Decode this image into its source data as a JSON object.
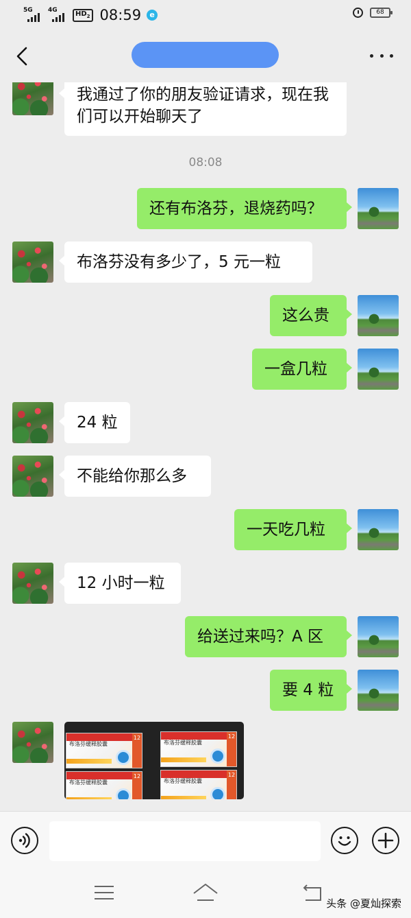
{
  "status_bar": {
    "network1": "5G",
    "network2": "4G",
    "hd_label": "HD",
    "hd_sub": "2",
    "time": "08:59",
    "app_badge": "e",
    "battery": "68"
  },
  "header": {
    "back_icon": "chevron-left-icon",
    "more_icon": "more-dots-icon"
  },
  "chat": {
    "messages": [
      {
        "side": "left",
        "type": "text",
        "text": "我通过了你的朋友验证请求，现在我们可以开始聊天了"
      },
      {
        "type": "timestamp",
        "text": "08:08"
      },
      {
        "side": "right",
        "type": "text",
        "text": "还有布洛芬，退烧药吗？"
      },
      {
        "side": "left",
        "type": "text",
        "text": "布洛芬没有多少了，5 元一粒"
      },
      {
        "side": "right",
        "type": "text",
        "text": "这么贵"
      },
      {
        "side": "right",
        "type": "text",
        "text": "一盒几粒"
      },
      {
        "side": "left",
        "type": "text",
        "text": "24 粒"
      },
      {
        "side": "left",
        "type": "text",
        "text": "不能给你那么多"
      },
      {
        "side": "right",
        "type": "text",
        "text": "一天吃几粒"
      },
      {
        "side": "left",
        "type": "text",
        "text": "12 小时一粒"
      },
      {
        "side": "right",
        "type": "text",
        "text": "给送过来吗？A 区"
      },
      {
        "side": "right",
        "type": "text",
        "text": "要 4 粒"
      },
      {
        "side": "left",
        "type": "image",
        "box_label": "布洛芬缓释胶囊",
        "box_count": "12"
      }
    ]
  },
  "input_bar": {
    "voice_icon": "voice-icon",
    "emoji_icon": "emoji-icon",
    "plus_icon": "plus-icon",
    "value": ""
  },
  "system_nav": {
    "menu_icon": "menu-icon",
    "home_icon": "home-icon",
    "back_icon": "back-icon",
    "watermark": "头条 @夏灿探索"
  },
  "colors": {
    "background": "#ededed",
    "sent_bubble": "#95ec69",
    "received_bubble": "#ffffff",
    "title_pill": "#5b94f5"
  }
}
